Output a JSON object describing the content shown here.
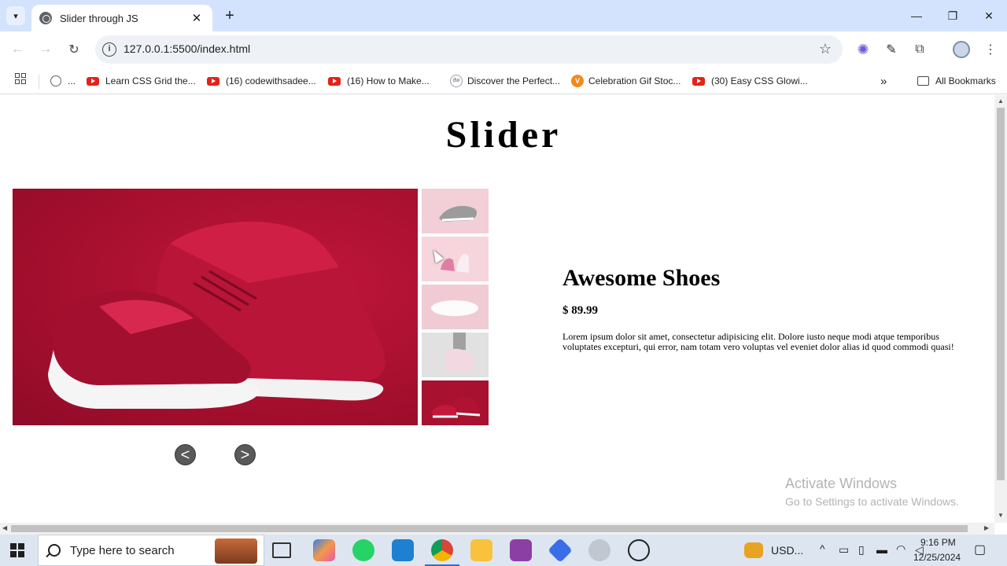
{
  "browser": {
    "tab_title": "Slider through JS",
    "tab_close": "✕",
    "new_tab": "+",
    "window_controls": {
      "minimize": "—",
      "restore": "❐",
      "close": "✕"
    },
    "url": "127.0.0.1:5500/index.html",
    "bookmarks": [
      {
        "icon": "globe-icon",
        "label": "..."
      },
      {
        "icon": "youtube-icon",
        "label": "Learn CSS Grid the..."
      },
      {
        "icon": "youtube-icon",
        "label": "(16) codewithsadee..."
      },
      {
        "icon": "youtube-icon",
        "label": "(16) How to Make..."
      },
      {
        "icon": "dw-icon",
        "label": "Discover the Perfect..."
      },
      {
        "icon": "vecteezy-icon",
        "label": "Celebration Gif Stoc..."
      },
      {
        "icon": "youtube-icon",
        "label": "(30) Easy CSS Glowi..."
      }
    ],
    "bookmarks_overflow": "»",
    "all_bookmarks": "All Bookmarks"
  },
  "page": {
    "heading": "Slider",
    "product_name": "Awesome Shoes",
    "price": "$ 89.99",
    "description": "Lorem ipsum dolor sit amet, consectetur adipisicing elit. Dolore iusto neque modi atque temporibus voluptates excepturi, qui error, nam totam vero voluptas vel eveniet dolor alias id quod commodi quasi!",
    "prev_label": "<",
    "next_label": ">",
    "thumbnails": [
      {
        "name": "thumb-shoe-side",
        "active": false
      },
      {
        "name": "thumb-shoe-pair",
        "active": false
      },
      {
        "name": "thumb-shoe-sole",
        "active": false
      },
      {
        "name": "thumb-shoe-worn",
        "active": false
      },
      {
        "name": "thumb-shoe-red",
        "active": true
      }
    ]
  },
  "watermark": {
    "line1": "Activate Windows",
    "line2": "Go to Settings to activate Windows."
  },
  "taskbar": {
    "search_placeholder": "Type here to search",
    "currency": "USD...",
    "time": "9:16 PM",
    "date": "12/25/2024"
  },
  "colors": {
    "tab_strip": "#d3e3fd",
    "shoe_background": "#a50f2e",
    "taskbar": "#dde6f0"
  }
}
